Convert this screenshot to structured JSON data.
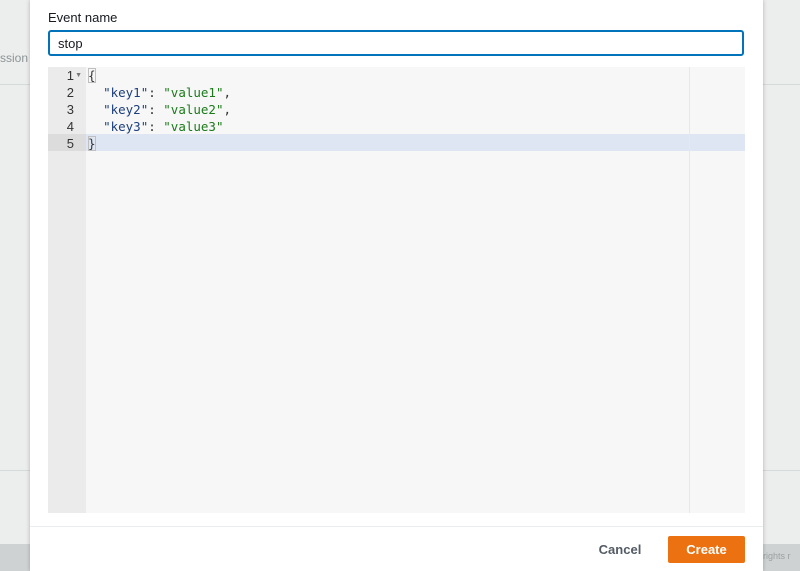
{
  "background": {
    "left_partial_text": "ssion",
    "right_partial_text": "rights r"
  },
  "modal": {
    "event_name_label": "Event name",
    "event_name_value": "stop"
  },
  "editor": {
    "line_numbers": [
      "1",
      "2",
      "3",
      "4",
      "5"
    ],
    "fold_icon": "fold-arrow-icon",
    "lines": [
      {
        "tokens": [
          {
            "type": "brace",
            "text": "{"
          }
        ]
      },
      {
        "tokens": [
          {
            "type": "plain",
            "text": "  "
          },
          {
            "type": "key",
            "text": "\"key1\""
          },
          {
            "type": "plain",
            "text": ": "
          },
          {
            "type": "str",
            "text": "\"value1\""
          },
          {
            "type": "plain",
            "text": ","
          }
        ]
      },
      {
        "tokens": [
          {
            "type": "plain",
            "text": "  "
          },
          {
            "type": "key",
            "text": "\"key2\""
          },
          {
            "type": "plain",
            "text": ": "
          },
          {
            "type": "str",
            "text": "\"value2\""
          },
          {
            "type": "plain",
            "text": ","
          }
        ]
      },
      {
        "tokens": [
          {
            "type": "plain",
            "text": "  "
          },
          {
            "type": "key",
            "text": "\"key3\""
          },
          {
            "type": "plain",
            "text": ": "
          },
          {
            "type": "str",
            "text": "\"value3\""
          }
        ]
      },
      {
        "tokens": [
          {
            "type": "brace",
            "text": "}"
          }
        ]
      }
    ],
    "active_line": 5
  },
  "footer": {
    "cancel_label": "Cancel",
    "create_label": "Create"
  },
  "colors": {
    "primary_button": "#ec7211",
    "input_focus_border": "#0073bb",
    "json_key": "#1c3e7c",
    "json_string": "#1a7a1a"
  }
}
